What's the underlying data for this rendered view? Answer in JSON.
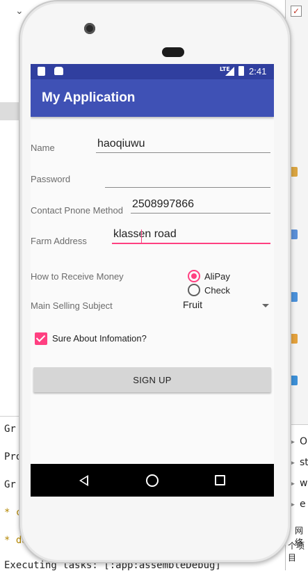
{
  "background": {
    "console_lines": [
      "Gr",
      "Pro",
      "Gr",
      "* c",
      "* da",
      "Executing tasks: [:app:assembleDebug]"
    ],
    "right_items": [
      "O",
      "st",
      "w",
      "e"
    ],
    "right_footer_1": "网络",
    "right_footer_2": "个项目"
  },
  "status_bar": {
    "network": "LTE",
    "time": "2:41"
  },
  "app_bar": {
    "title": "My Application"
  },
  "form": {
    "name": {
      "label": "Name",
      "value": "haoqiuwu"
    },
    "password": {
      "label": "Password",
      "value": ""
    },
    "contact": {
      "label": "Contact Pnone Method",
      "value": "2508997866"
    },
    "farm_address": {
      "label": "Farm Address",
      "value": "klassen road"
    },
    "receive_money": {
      "label": "How to Receive Money",
      "options": [
        "AliPay",
        "Check"
      ],
      "selected": "AliPay"
    },
    "selling_subject": {
      "label": "Main Selling Subject",
      "value": "Fruit"
    },
    "confirm": {
      "label": "Sure About Infomation?",
      "checked": true
    },
    "submit_label": "SIGN UP"
  },
  "colors": {
    "status_bar": "#303f9f",
    "app_bar": "#3f51b5",
    "accent": "#ff4081",
    "navbar": "#000000"
  },
  "nav_icons": [
    "back-icon",
    "home-icon",
    "recents-icon"
  ]
}
